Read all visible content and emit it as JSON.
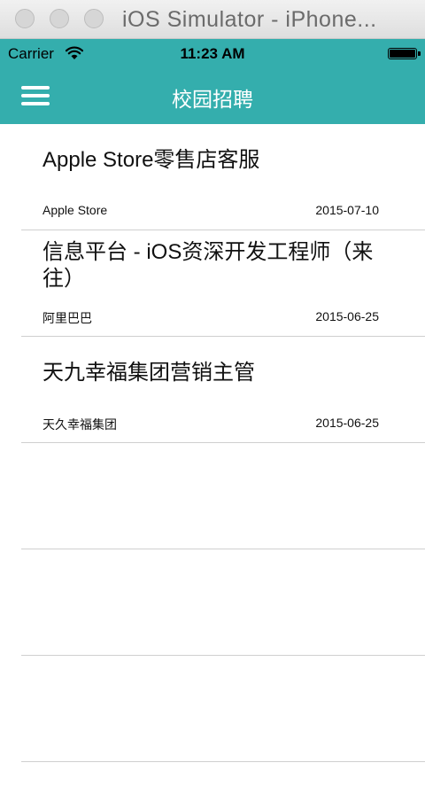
{
  "window": {
    "title": "iOS Simulator - iPhone..."
  },
  "status_bar": {
    "carrier": "Carrier",
    "time": "11:23 AM"
  },
  "nav": {
    "title": "校园招聘"
  },
  "jobs": [
    {
      "title": "Apple Store零售店客服",
      "company": "Apple Store",
      "date": "2015-07-10"
    },
    {
      "title": "信息平台 - iOS资深开发工程师（来往）",
      "company": "阿里巴巴",
      "date": "2015-06-25"
    },
    {
      "title": "天九幸福集团营销主管",
      "company": "天久幸福集团",
      "date": "2015-06-25"
    }
  ],
  "colors": {
    "accent": "#34aead"
  }
}
